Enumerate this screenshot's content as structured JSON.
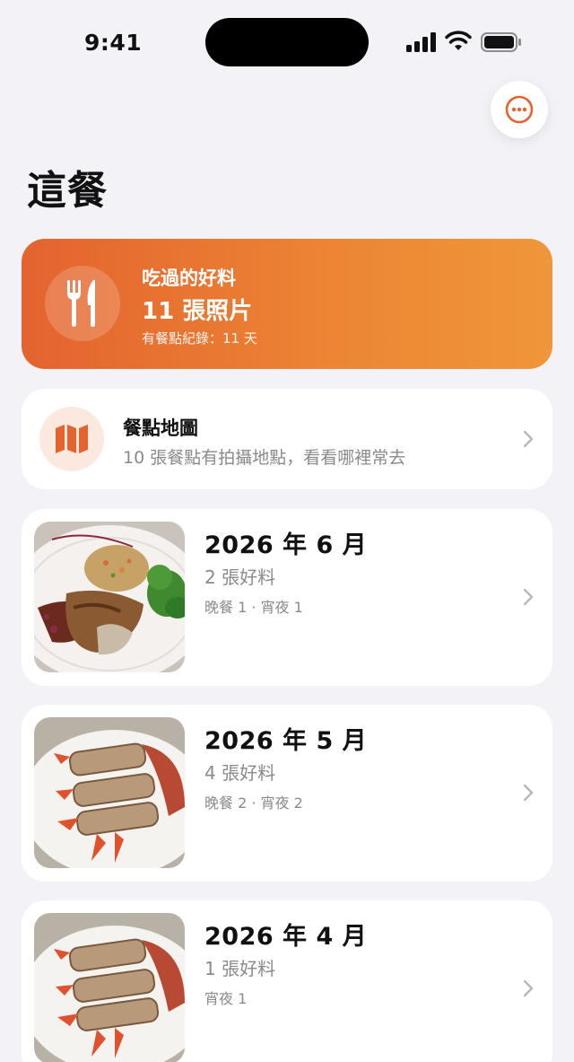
{
  "status": {
    "time": "9:41"
  },
  "header": {
    "title": "這餐",
    "more_icon": "ellipsis-circle-icon"
  },
  "hero": {
    "icon": "fork-knife-icon",
    "label": "吃過的好料",
    "count": "11 張照片",
    "subtitle": "有餐點紀錄：11 天",
    "gradient_start": "#e4632f",
    "gradient_end": "#f0963a"
  },
  "map_card": {
    "icon": "map-icon",
    "title": "餐點地圖",
    "subtitle": "10 張餐點有拍攝地點，看看哪裡常去"
  },
  "months": [
    {
      "title": "2026 年 6 月",
      "count": "2 張好料",
      "detail": "晚餐 1 · 宵夜 1"
    },
    {
      "title": "2026 年 5 月",
      "count": "4 張好料",
      "detail": "晚餐 2 · 宵夜 2"
    },
    {
      "title": "2026 年 4 月",
      "count": "1 張好料",
      "detail": "宵夜 1"
    }
  ],
  "colors": {
    "accent": "#e4632f",
    "background": "#f2f2f7",
    "secondary_text": "#8a8a8e"
  }
}
